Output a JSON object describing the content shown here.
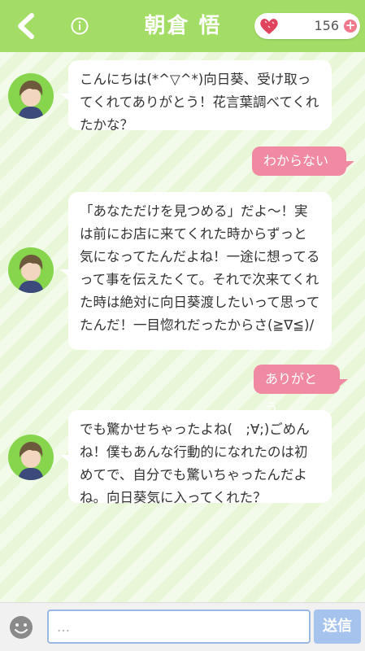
{
  "header": {
    "title": "朝倉 悟",
    "points": "156"
  },
  "messages": [
    {
      "from": "partner",
      "text": "こんにちは(*^▽^*)向日葵、受け取ってくれてありがとう！花言葉調べてくれたかな？"
    },
    {
      "from": "me",
      "text": "わからない"
    },
    {
      "from": "partner",
      "text": "「あなただけを見つめる」だよ～！実は前にお店に来てくれた時からずっと気になってたんだよね！一途に想ってるって事を伝えたくて。それで次来てくれた時は絶対に向日葵渡したいって思ってたんだ！一目惚れだったからさ(≧∇≦)/"
    },
    {
      "from": "me",
      "text": "ありがとう"
    },
    {
      "from": "partner",
      "text": "でも驚かせちゃったよね(　;∀;)ごめんね！僕もあんな行動的になれたのは初めてで、自分でも驚いちゃったんだよね。向日葵気に入ってくれた？"
    }
  ],
  "input": {
    "placeholder": "…",
    "send_label": "送信"
  },
  "colors": {
    "header": "#a3dd66",
    "outgoing_bubble": "#f08aa2",
    "send_button": "#a6c3ee"
  }
}
